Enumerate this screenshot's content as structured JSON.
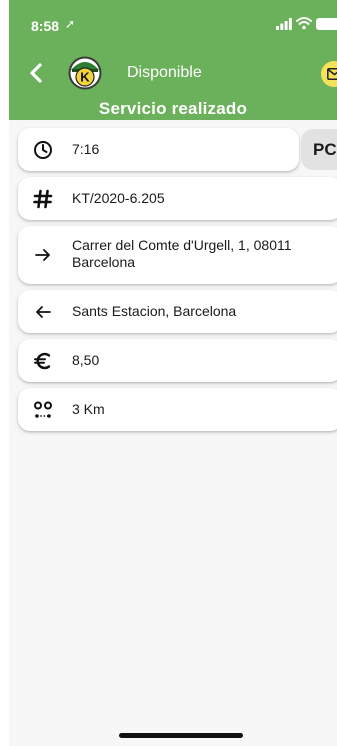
{
  "status_bar": {
    "time": "8:58",
    "location_arrow": "➚"
  },
  "header": {
    "availability": "Disponible",
    "title": "Servicio realizado",
    "logo_letter": "K"
  },
  "service": {
    "time": "7:16",
    "badge": "PC",
    "reference": "KT/2020-6.205",
    "origin": "Carrer del Comte d'Urgell, 1, 08011 Barcelona",
    "destination": "Sants Estacion, Barcelona",
    "price": "8,50",
    "distance": "3 Km"
  },
  "icons": {
    "time": "clock-icon",
    "reference": "hash-icon",
    "origin": "arrow-right-icon",
    "destination": "arrow-left-icon",
    "price": "euro-icon",
    "distance": "route-icon",
    "messages": "envelope-icon",
    "back": "chevron-left-icon"
  },
  "colors": {
    "header_green": "#6bb05a",
    "badge_gray": "#e2e2e2",
    "messages_yellow": "#f4e25a",
    "logo_yellow": "#f2d43a"
  }
}
